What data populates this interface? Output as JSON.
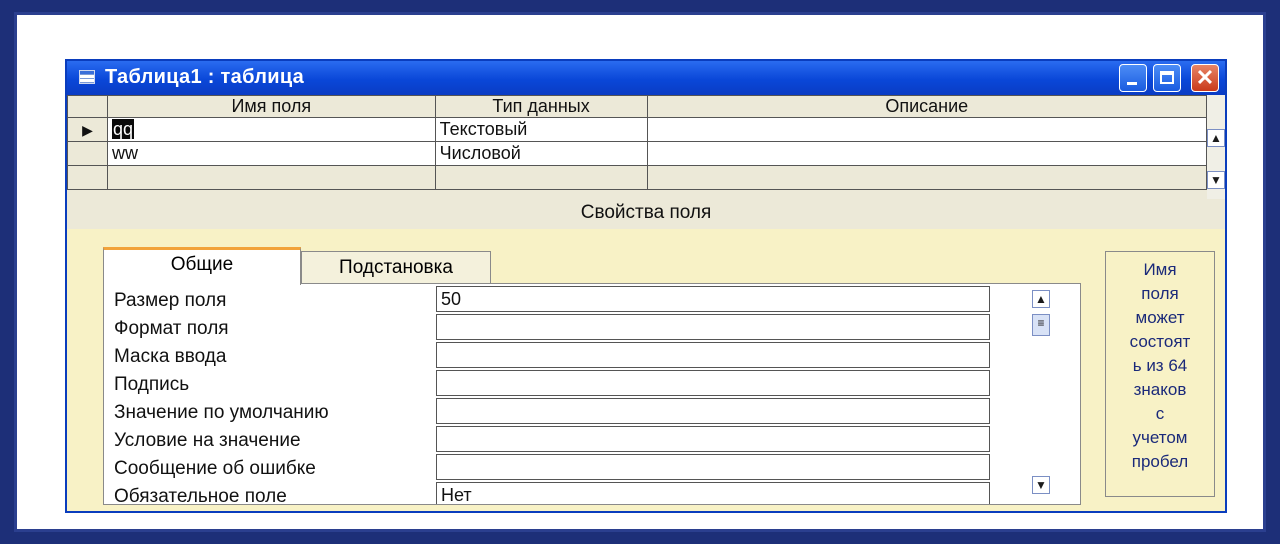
{
  "window": {
    "title": "Таблица1 : таблица"
  },
  "grid": {
    "headers": [
      "Имя поля",
      "Тип данных",
      "Описание"
    ],
    "rows": [
      {
        "name": "qq",
        "type": "Текстовый",
        "desc": ""
      },
      {
        "name": "ww",
        "type": "Числовой",
        "desc": ""
      }
    ]
  },
  "section": {
    "title": "Свойства поля"
  },
  "tabs": {
    "general": "Общие",
    "lookup": "Подстановка"
  },
  "properties": [
    {
      "label": "Размер поля",
      "value": "50"
    },
    {
      "label": "Формат поля",
      "value": ""
    },
    {
      "label": "Маска ввода",
      "value": ""
    },
    {
      "label": "Подпись",
      "value": ""
    },
    {
      "label": "Значение по умолчанию",
      "value": ""
    },
    {
      "label": "Условие на значение",
      "value": ""
    },
    {
      "label": "Сообщение об ошибке",
      "value": ""
    },
    {
      "label": "Обязательное поле",
      "value": "Нет"
    }
  ],
  "help": {
    "text": "Имя\nполя\nможет\nсостоят\nь из 64\nзнаков\nс\nучетом\nпробел"
  },
  "icons": {
    "window": "table-icon",
    "minimize": "minimize-icon",
    "maximize": "maximize-icon",
    "close": "close-icon",
    "up": "scroll-up-icon",
    "down": "scroll-down-icon",
    "selector": "record-selector-arrow-icon"
  },
  "colors": {
    "titlebar": "#0a47d8",
    "frame": "#1d2f78",
    "properties_bg": "#f8f2c6",
    "help_text": "#1b2a7a",
    "tab_accent": "#f2a33a"
  }
}
